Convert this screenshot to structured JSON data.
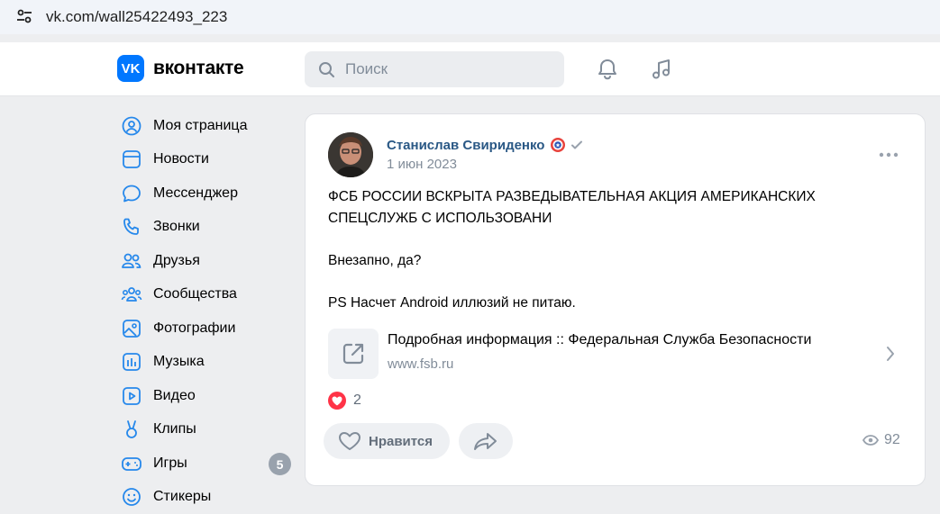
{
  "browser": {
    "url": "vk.com/wall25422493_223"
  },
  "header": {
    "logo_text": "вконтакте",
    "search": {
      "placeholder": "Поиск"
    }
  },
  "sidebar": {
    "items": [
      {
        "label": "Моя страница",
        "icon": "user-circle-icon"
      },
      {
        "label": "Новости",
        "icon": "news-icon"
      },
      {
        "label": "Мессенджер",
        "icon": "message-icon"
      },
      {
        "label": "Звонки",
        "icon": "phone-icon"
      },
      {
        "label": "Друзья",
        "icon": "friends-icon"
      },
      {
        "label": "Сообщества",
        "icon": "communities-icon"
      },
      {
        "label": "Фотографии",
        "icon": "photo-icon"
      },
      {
        "label": "Музыка",
        "icon": "music-icon"
      },
      {
        "label": "Видео",
        "icon": "video-icon"
      },
      {
        "label": "Клипы",
        "icon": "clips-icon"
      },
      {
        "label": "Игры",
        "icon": "gamepad-icon",
        "badge": "5"
      },
      {
        "label": "Стикеры",
        "icon": "smile-icon"
      }
    ]
  },
  "post": {
    "author": "Станислав Свириденко",
    "date": "1 июн 2023",
    "text": {
      "line1": "ФСБ РОССИИ ВСКРЫТА РАЗВЕДЫВАТЕЛЬНАЯ АКЦИЯ АМЕРИКАНСКИХ",
      "line2": "СПЕЦСЛУЖБ С ИСПОЛЬЗОВАНИ",
      "line3": "Внезапно, да?",
      "line4": "PS Насчет Android иллюзий не питаю."
    },
    "link": {
      "title": "Подробная информация :: Федеральная Служба Безопасности",
      "domain": "www.fsb.ru"
    },
    "reactions_count": "2",
    "like_label": "Нравится",
    "views": "92"
  },
  "colors": {
    "brand": "#0077ff",
    "author_link": "#2a5885",
    "secondary_text": "#818c99",
    "reaction_heart": "#ff3347",
    "page_bg": "#edeef0"
  }
}
